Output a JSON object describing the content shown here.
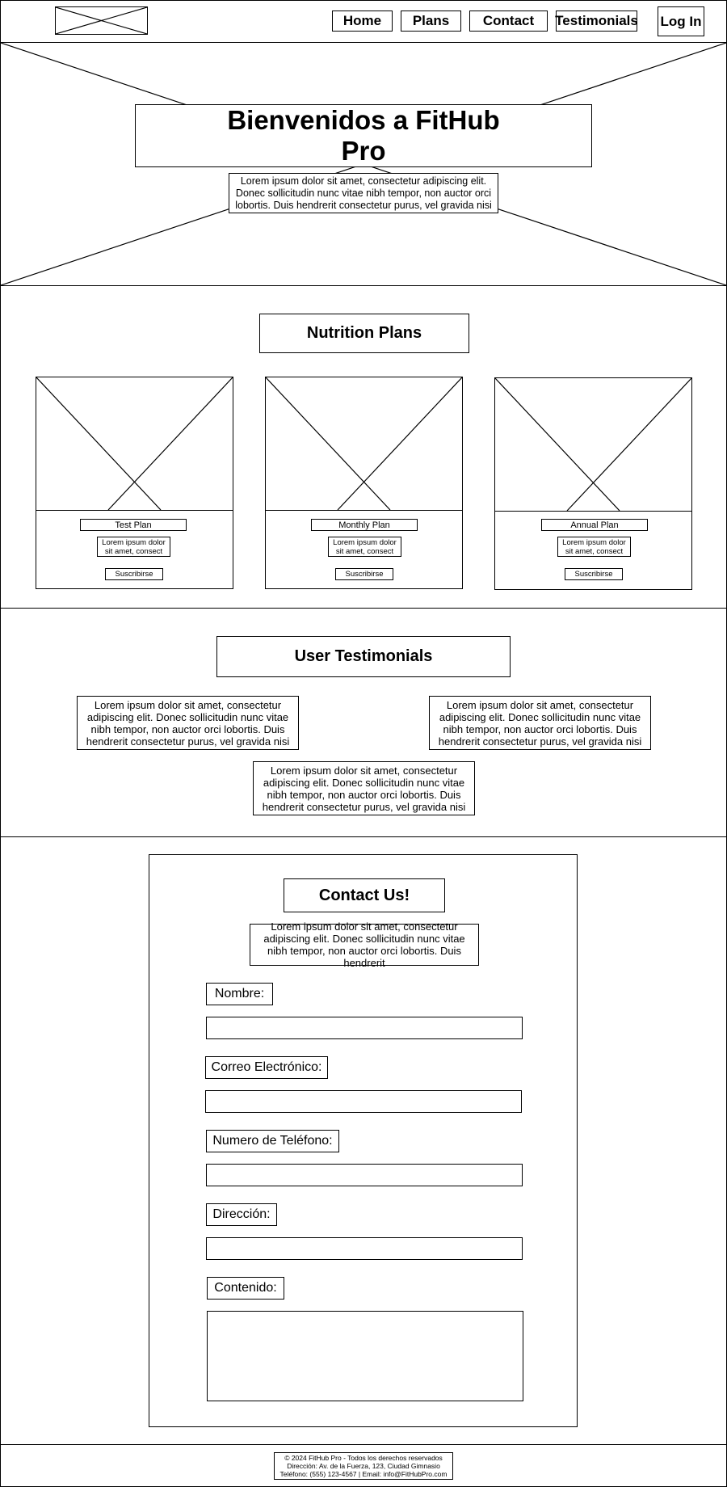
{
  "header": {
    "logo_icon": "image-placeholder-icon",
    "nav": [
      "Home",
      "Plans",
      "Contact",
      "Testimonials"
    ],
    "login_label": "Log In"
  },
  "hero": {
    "title_line1": "Bienvenidos a FitHub",
    "title_line2": "Pro",
    "text": "Lorem ipsum dolor sit amet, consectetur adipiscing elit. Donec sollicitudin nunc vitae nibh tempor, non auctor orci lobortis. Duis hendrerit consectetur purus, vel gravida nisi"
  },
  "plans": {
    "heading": "Nutrition Plans",
    "cards": [
      {
        "name": "Test Plan",
        "desc": "Lorem ipsum dolor sit amet, consect",
        "cta": "Suscribirse"
      },
      {
        "name": "Monthly Plan",
        "desc": "Lorem ipsum dolor sit amet, consect",
        "cta": "Suscribirse"
      },
      {
        "name": "Annual Plan",
        "desc": "Lorem ipsum dolor sit amet, consect",
        "cta": "Suscribirse"
      }
    ]
  },
  "testimonials": {
    "heading": "User Testimonials",
    "items": [
      "Lorem ipsum dolor sit amet, consectetur adipiscing elit. Donec sollicitudin nunc vitae nibh tempor, non auctor orci lobortis. Duis hendrerit consectetur purus, vel gravida nisi",
      "Lorem ipsum dolor sit amet, consectetur adipiscing elit. Donec sollicitudin nunc vitae nibh tempor, non auctor orci lobortis. Duis hendrerit consectetur purus, vel gravida nisi",
      "Lorem ipsum dolor sit amet, consectetur adipiscing elit. Donec sollicitudin nunc vitae nibh tempor, non auctor orci lobortis. Duis hendrerit consectetur purus, vel gravida nisi"
    ]
  },
  "contact": {
    "heading": "Contact Us!",
    "text": "Lorem ipsum dolor sit amet, consectetur adipiscing elit. Donec sollicitudin nunc vitae nibh tempor, non auctor orci lobortis. Duis hendrerit",
    "fields": {
      "name_label": "Nombre:",
      "email_label": "Correo Electrónico:",
      "phone_label": "Numero de Teléfono:",
      "address_label": "Dirección:",
      "content_label": "Contenido:"
    }
  },
  "footer": {
    "line1": "© 2024 FitHub Pro - Todos los derechos reservados",
    "line2": "Dirección: Av. de la Fuerza, 123, Ciudad Gimnasio",
    "line3": "Teléfono: (555) 123-4567 | Email: info@FitHubPro.com"
  }
}
